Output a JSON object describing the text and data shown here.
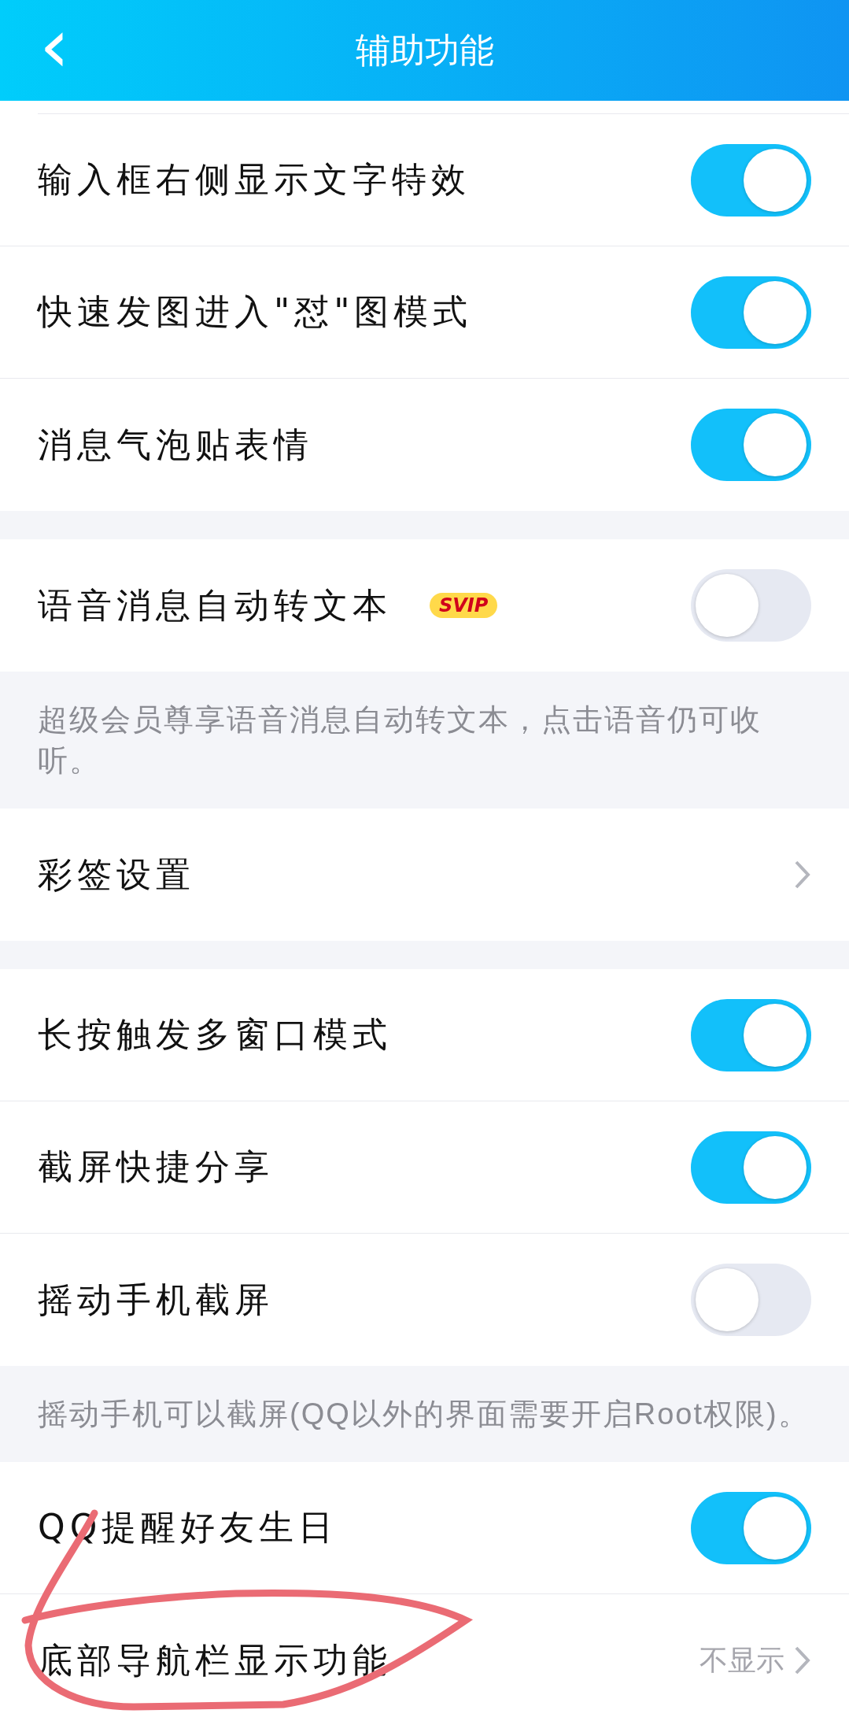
{
  "header": {
    "back": "‹",
    "title": "辅助功能"
  },
  "blocks": [
    {
      "kind": "card",
      "top_sliver": true,
      "rows": [
        {
          "kind": "toggle",
          "label": "输入框右侧显示文字特效",
          "on": true
        },
        {
          "kind": "toggle",
          "label": "快速发图进入\"怼\"图模式",
          "on": true
        },
        {
          "kind": "toggle",
          "label": "消息气泡贴表情",
          "on": true
        }
      ]
    },
    {
      "kind": "card",
      "rows": [
        {
          "kind": "toggle",
          "label": "语音消息自动转文本",
          "badge": "SVIP",
          "on": false
        }
      ]
    },
    {
      "kind": "note",
      "text": "超级会员尊享语音消息自动转文本，点击语音仍可收听。"
    },
    {
      "kind": "card",
      "rows": [
        {
          "kind": "link",
          "label": "彩签设置"
        }
      ]
    },
    {
      "kind": "card",
      "rows": [
        {
          "kind": "toggle",
          "label": "长按触发多窗口模式",
          "on": true
        },
        {
          "kind": "toggle",
          "label": "截屏快捷分享",
          "on": true
        },
        {
          "kind": "toggle",
          "label": "摇动手机截屏",
          "on": false
        }
      ]
    },
    {
      "kind": "note",
      "text": "摇动手机可以截屏(QQ以外的界面需要开启Root权限)。"
    },
    {
      "kind": "card",
      "rows": [
        {
          "kind": "toggle",
          "label": "QQ提醒好友生日",
          "on": true
        },
        {
          "kind": "link",
          "label": "底部导航栏显示功能",
          "value": "不显示"
        }
      ]
    }
  ],
  "annotation": {
    "kind": "hand-drawn-circle"
  }
}
